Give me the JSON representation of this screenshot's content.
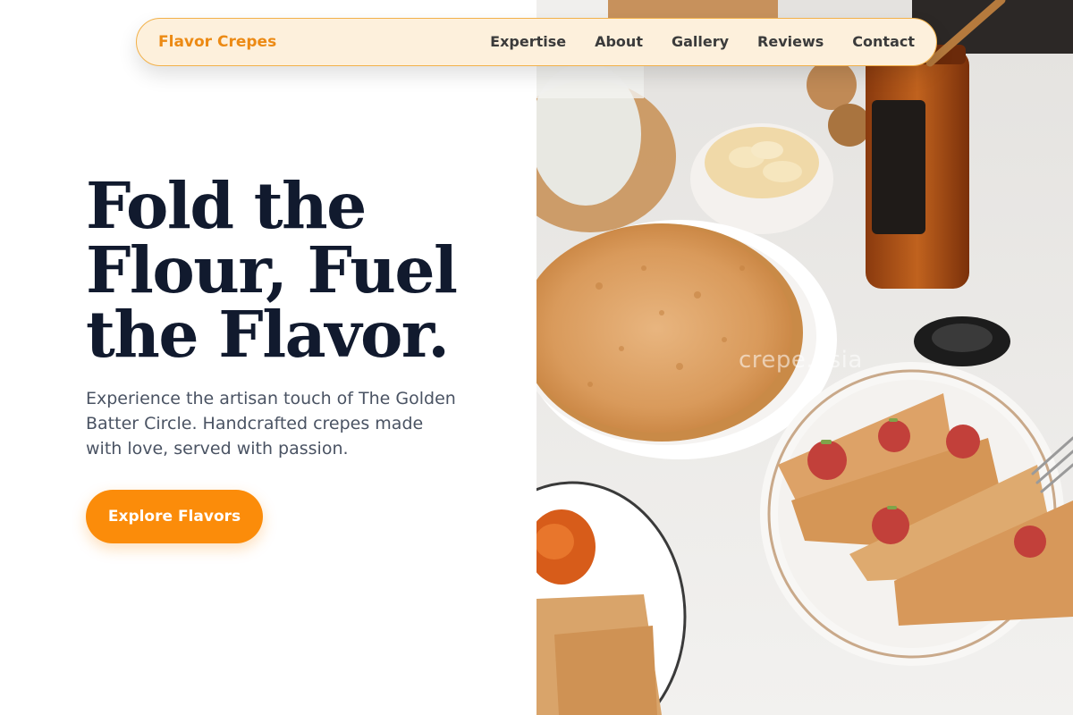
{
  "nav": {
    "brand": "Flavor Crepes",
    "links": [
      "Expertise",
      "About",
      "Gallery",
      "Reviews",
      "Contact"
    ]
  },
  "hero": {
    "title_lines": [
      "Fold the",
      "Flour, Fuel",
      "the Flavor."
    ],
    "subtitle": "Experience the artisan touch of The Golden Batter Circle. Handcrafted crepes made with love, served with passion.",
    "cta_label": "Explore Flavors"
  },
  "image": {
    "watermark": "crepe.asia"
  },
  "colors": {
    "accent": "#fb8c0a",
    "brand_text": "#ec8a14",
    "nav_bg": "#fdf0dc",
    "title": "#111a2e",
    "body_text": "#4a5363"
  }
}
